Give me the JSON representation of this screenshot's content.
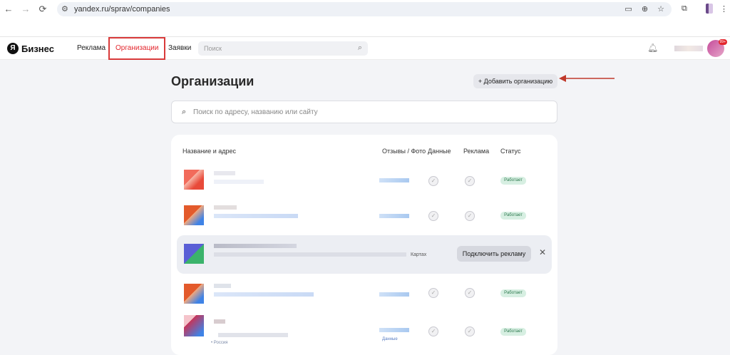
{
  "browser": {
    "url": "yandex.ru/sprav/companies",
    "back_icon": "←",
    "forward_icon": "→",
    "reload_icon": "⟳"
  },
  "header": {
    "logo_mark": "Я",
    "logo_text": "Бизнес",
    "nav": [
      "Реклама",
      "Организации",
      "Заявки"
    ],
    "search_placeholder": "Поиск",
    "avatar_badge": "99+"
  },
  "page": {
    "title": "Организации",
    "add_button": "Добавить организацию",
    "search_placeholder": "Поиск по адресу, названию или сайту"
  },
  "table": {
    "columns": [
      "Название и адрес",
      "Отзывы / Фото",
      "Данные",
      "Реклама",
      "Статус"
    ],
    "status_label": "Работает",
    "rows_count": 5
  },
  "promo": {
    "partial_text": "Картах",
    "button": "Подключить рекламу",
    "close": "✕"
  },
  "footer_partial": {
    "country": "Россия",
    "data_label": "Данные"
  },
  "colors": {
    "accent_red": "#e3262d",
    "status_bg": "#d7efe2",
    "status_text": "#2e7a4f"
  }
}
